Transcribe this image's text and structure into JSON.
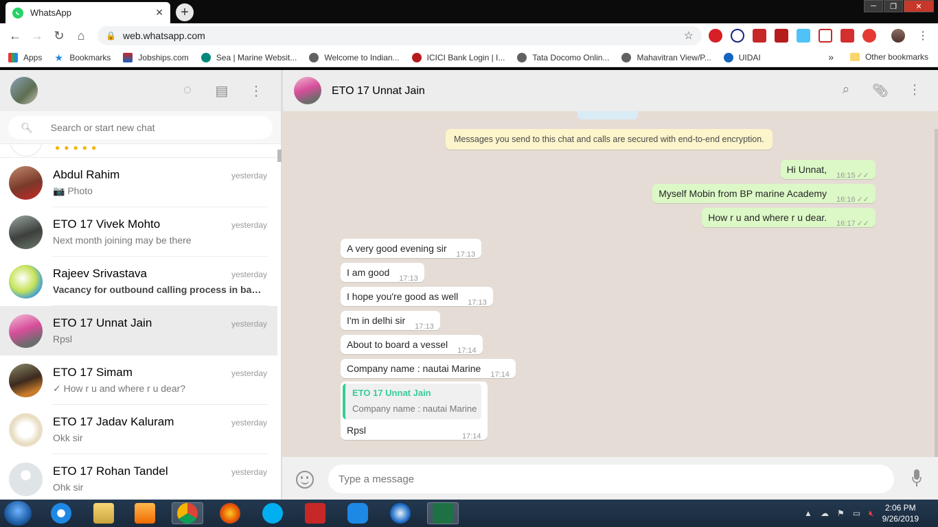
{
  "browser": {
    "tab_title": "WhatsApp",
    "url": "web.whatsapp.com",
    "bookmarks": [
      "Apps",
      "Bookmarks",
      "Jobships.com",
      "Sea | Marine Websit...",
      "Welcome to Indian...",
      "ICICI Bank Login | I...",
      "Tata Docomo Onlin...",
      "Mahavitran View/P...",
      "UIDAI"
    ],
    "other_bookmarks": "Other bookmarks",
    "more": "»"
  },
  "sidebar": {
    "search_placeholder": "Search or start new chat",
    "chats": [
      {
        "name": "Abdul Rahim",
        "time": "yesterday",
        "last": "📷 Photo",
        "bold": false
      },
      {
        "name": "ETO 17 Vivek Mohto",
        "time": "yesterday",
        "last": "Next month joining may be there",
        "bold": false
      },
      {
        "name": "Rajeev Srivastava",
        "time": "yesterday",
        "last": "Vacancy for outbound calling process in ban...",
        "bold": true
      },
      {
        "name": "ETO 17 Unnat Jain",
        "time": "yesterday",
        "last": "Rpsl",
        "bold": false
      },
      {
        "name": "ETO 17 Simam",
        "time": "yesterday",
        "last": "✓ How r u and where r u dear?",
        "bold": false
      },
      {
        "name": "ETO 17 Jadav Kaluram",
        "time": "yesterday",
        "last": "Okk sir",
        "bold": false
      },
      {
        "name": "ETO 17 Rohan Tandel",
        "time": "yesterday",
        "last": "Ohk sir",
        "bold": false
      }
    ]
  },
  "conversation": {
    "contact_name": "ETO 17 Unnat Jain",
    "encryption_notice": "Messages you send to this chat and calls are secured with end-to-end encryption.",
    "outgoing": [
      {
        "text": "Hi Unnat,",
        "time": "16:15"
      },
      {
        "text": "Myself Mobin from BP marine Academy",
        "time": "16:16"
      },
      {
        "text": "How r u and where r u dear.",
        "time": "16:17"
      }
    ],
    "incoming": [
      {
        "text": "A very good evening sir",
        "time": "17:13"
      },
      {
        "text": "I am good",
        "time": "17:13"
      },
      {
        "text": "I hope you're good as well",
        "time": "17:13"
      },
      {
        "text": "I'm in delhi sir",
        "time": "17:13"
      },
      {
        "text": "About to board a vessel",
        "time": "17:14"
      },
      {
        "text": "Company name : nautai Marine",
        "time": "17:14"
      }
    ],
    "reply": {
      "quoted_name": "ETO 17 Unnat Jain",
      "quoted_text": "Company name : nautai Marine",
      "text": "Rpsl",
      "time": "17:14"
    },
    "composer_placeholder": "Type a message"
  },
  "taskbar": {
    "time": "2:06 PM",
    "date": "9/26/2019"
  }
}
